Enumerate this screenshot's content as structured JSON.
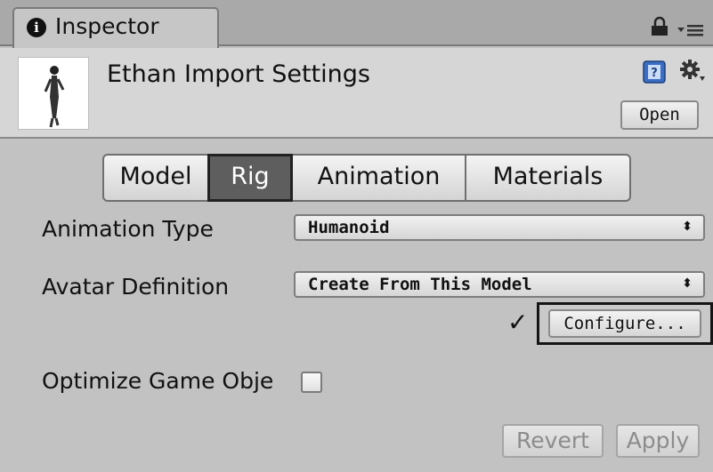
{
  "panel": {
    "tab_label": "Inspector",
    "info_glyph": "i",
    "icons": [
      "info-icon",
      "lock-icon",
      "menu-icon",
      "help-book-icon",
      "gear-icon"
    ]
  },
  "header": {
    "title": "Ethan Import Settings",
    "open_label": "Open"
  },
  "tabs": [
    {
      "label": "Model",
      "selected": false
    },
    {
      "label": "Rig",
      "selected": true
    },
    {
      "label": "Animation",
      "selected": false
    },
    {
      "label": "Materials",
      "selected": false
    }
  ],
  "fields": {
    "animation_type": {
      "label": "Animation Type",
      "value": "Humanoid"
    },
    "avatar_definition": {
      "label": "Avatar Definition",
      "value": "Create From This Model"
    },
    "configure_label": "Configure...",
    "configure_status": "✓",
    "optimize": {
      "label": "Optimize Game Obje",
      "checked": false
    }
  },
  "footer": {
    "revert_label": "Revert",
    "apply_label": "Apply"
  },
  "colors": {
    "background": "#c2c2c2",
    "selected_tab": "#5e5e5e",
    "disabled_text": "#8c8c8c"
  }
}
